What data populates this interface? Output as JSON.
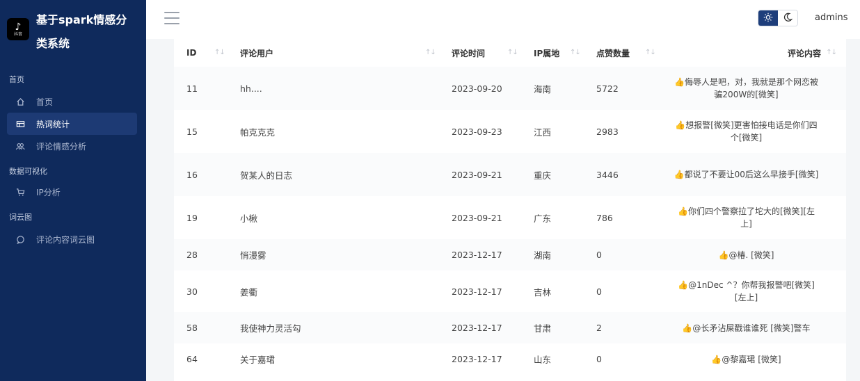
{
  "brand": {
    "logo_glyph": "♪",
    "logo_sub": "抖音",
    "title": "基于spark情感分类系统"
  },
  "sidebar": {
    "groups": [
      {
        "label": "首页",
        "items": [
          {
            "label": "首页",
            "icon": "home-icon",
            "active": false
          },
          {
            "label": "热词统计",
            "icon": "table-icon",
            "active": true
          },
          {
            "label": "评论情感分析",
            "icon": "users-icon",
            "active": false
          }
        ]
      },
      {
        "label": "数据可视化",
        "items": [
          {
            "label": "IP分析",
            "icon": "cart-icon",
            "active": false
          }
        ]
      },
      {
        "label": "词云图",
        "items": [
          {
            "label": "评论内容词云图",
            "icon": "chat-icon",
            "active": false
          }
        ]
      }
    ]
  },
  "header": {
    "user": "admins",
    "theme": "light"
  },
  "table": {
    "columns": [
      {
        "key": "id",
        "label": "ID"
      },
      {
        "key": "user",
        "label": "评论用户"
      },
      {
        "key": "time",
        "label": "评论时间"
      },
      {
        "key": "ip",
        "label": "IP属地"
      },
      {
        "key": "likes",
        "label": "点赞数量"
      },
      {
        "key": "content",
        "label": "评论内容"
      }
    ],
    "rows": [
      {
        "id": "11",
        "user": "hh....",
        "time": "2023-09-20",
        "ip": "海南",
        "likes": "5722",
        "content": "侮辱人是吧，对，我就是那个网恋被骗200W的[微笑]"
      },
      {
        "id": "15",
        "user": "帕克克克",
        "time": "2023-09-23",
        "ip": "江西",
        "likes": "2983",
        "content": "想报警[微笑]更害怕接电话是你们四个[微笑]"
      },
      {
        "id": "16",
        "user": "贺某人的日志",
        "time": "2023-09-21",
        "ip": "重庆",
        "likes": "3446",
        "content": "都说了不要让00后这么早接手[微笑]"
      },
      {
        "id": "19",
        "user": "小楸",
        "time": "2023-09-21",
        "ip": "广东",
        "likes": "786",
        "content": "你们四个警察拉了坨大的[微笑][左上]"
      },
      {
        "id": "28",
        "user": "悄漫雾",
        "time": "2023-12-17",
        "ip": "湖南",
        "likes": "0",
        "content": "@椿. [微笑]"
      },
      {
        "id": "30",
        "user": "姜衢",
        "time": "2023-12-17",
        "ip": "吉林",
        "likes": "0",
        "content": "@1nDec ^？你帮我报警吧[微笑][左上]"
      },
      {
        "id": "58",
        "user": "我使神力灵活勾",
        "time": "2023-12-17",
        "ip": "甘肃",
        "likes": "2",
        "content": "@长矛沾屎戳谁谁死 [微笑]警车"
      },
      {
        "id": "64",
        "user": "关于嘉珺",
        "time": "2023-12-17",
        "ip": "山东",
        "likes": "0",
        "content": "@黎嘉珺 [微笑]"
      }
    ]
  }
}
